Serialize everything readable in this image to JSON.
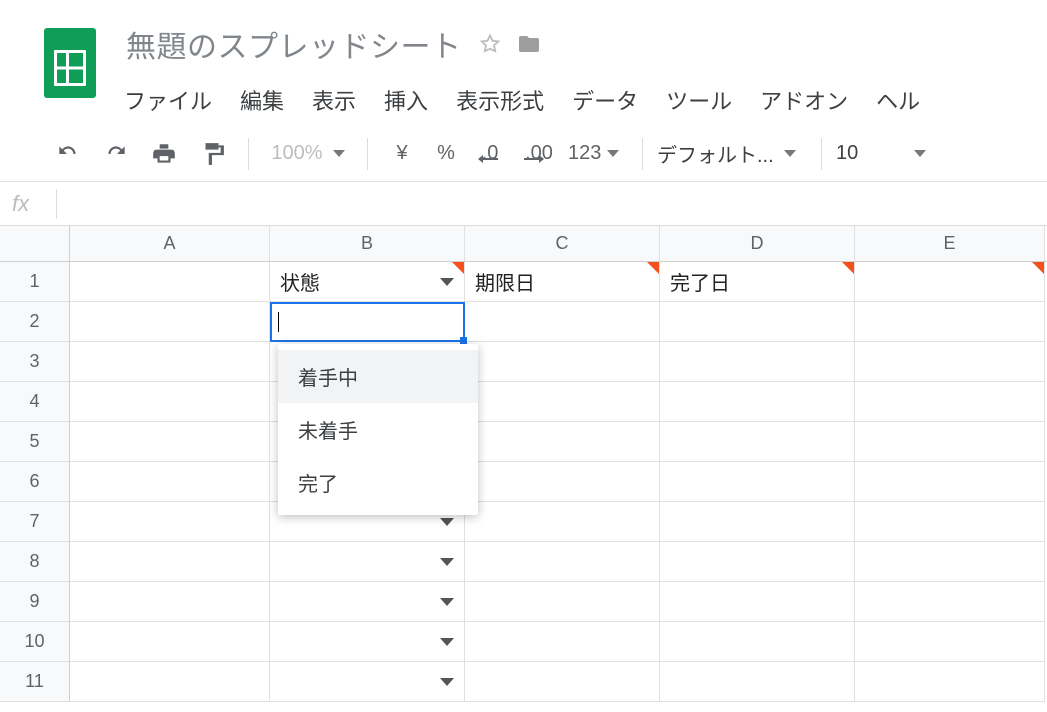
{
  "doc": {
    "title": "無題のスプレッドシート"
  },
  "menu": {
    "file": "ファイル",
    "edit": "編集",
    "view": "表示",
    "insert": "挿入",
    "format": "表示形式",
    "data": "データ",
    "tools": "ツール",
    "addons": "アドオン",
    "help": "ヘル"
  },
  "toolbar": {
    "zoom": "100%",
    "currency": "¥",
    "percent": "%",
    "dec_dec": ".0",
    "inc_dec": ".00",
    "numfmt": "123",
    "font": "デフォルト...",
    "size": "10"
  },
  "fx": {
    "label": "fx",
    "value": ""
  },
  "columns": [
    "A",
    "B",
    "C",
    "D",
    "E"
  ],
  "rows": [
    "1",
    "2",
    "3",
    "4",
    "5",
    "6",
    "7",
    "8",
    "9",
    "10",
    "11"
  ],
  "headers": {
    "b1": "状態",
    "c1": "期限日",
    "d1": "完了日"
  },
  "dropdown": {
    "opt1": "着手中",
    "opt2": "未着手",
    "opt3": "完了"
  },
  "active_cell": "B2"
}
